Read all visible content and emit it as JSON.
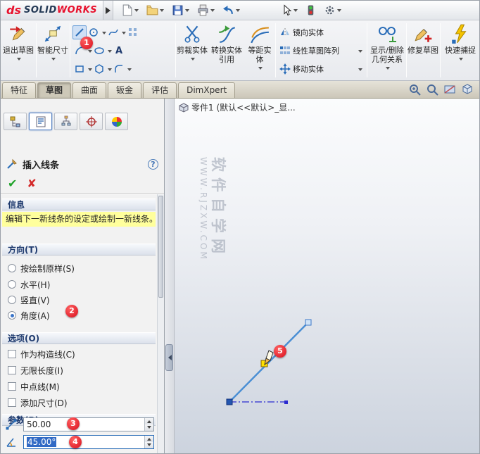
{
  "titlebar": {
    "logo_ds": "ds",
    "logo_solid": "SOLID",
    "logo_works": "WORKS"
  },
  "ribbon": {
    "exit_sketch": "退出草图",
    "smart_dimension": "智能尺寸",
    "trim_entities": "剪裁实体",
    "convert_entities": "转换实体引用",
    "offset_entities": "等距实体",
    "mirror_entities": "镜向实体",
    "linear_sketch_pattern": "线性草图阵列",
    "move_entities": "移动实体",
    "display_delete_relations": "显示/删除几何关系",
    "repair_sketch": "修复草图",
    "quick_snaps": "快速捕捉",
    "text_tool_label": "A"
  },
  "tabs": {
    "features": "特征",
    "sketch": "草图",
    "surfaces": "曲面",
    "sheet_metal": "钣金",
    "evaluate": "评估",
    "dimxpert": "DimXpert"
  },
  "panel": {
    "title": "插入线条",
    "help_label": "?",
    "ok_icon": "✔",
    "cancel_icon": "✘",
    "message_header": "信息",
    "message": "编辑下一新线条的设定或绘制一新线条。",
    "orientation_header": "方向(T)",
    "orientation": [
      {
        "label": "按绘制原样(S)",
        "selected": false
      },
      {
        "label": "水平(H)",
        "selected": false
      },
      {
        "label": "竖直(V)",
        "selected": false
      },
      {
        "label": "角度(A)",
        "selected": true
      }
    ],
    "options_header": "选项(O)",
    "options": [
      {
        "label": "作为构造线(C)",
        "checked": false
      },
      {
        "label": "无限长度(I)",
        "checked": false
      },
      {
        "label": "中点线(M)",
        "checked": false
      },
      {
        "label": "添加尺寸(D)",
        "checked": false
      }
    ],
    "parameters_header": "参数(R)",
    "length_value": "50.00",
    "angle_value": "45.00°"
  },
  "viewport": {
    "tree_item": "零件1 (默认<<默认>_显...",
    "watermark_line1": "软件自学网",
    "watermark_line2": "WWW.RJZXW.COM"
  },
  "badges": {
    "1": "1",
    "2": "2",
    "3": "3",
    "4": "4",
    "5": "5"
  },
  "colors": {
    "badge": "#d80f1e",
    "sketch_line": "#4b8fd4",
    "selection": "#316ac5",
    "message_bg": "#ffff9c"
  }
}
